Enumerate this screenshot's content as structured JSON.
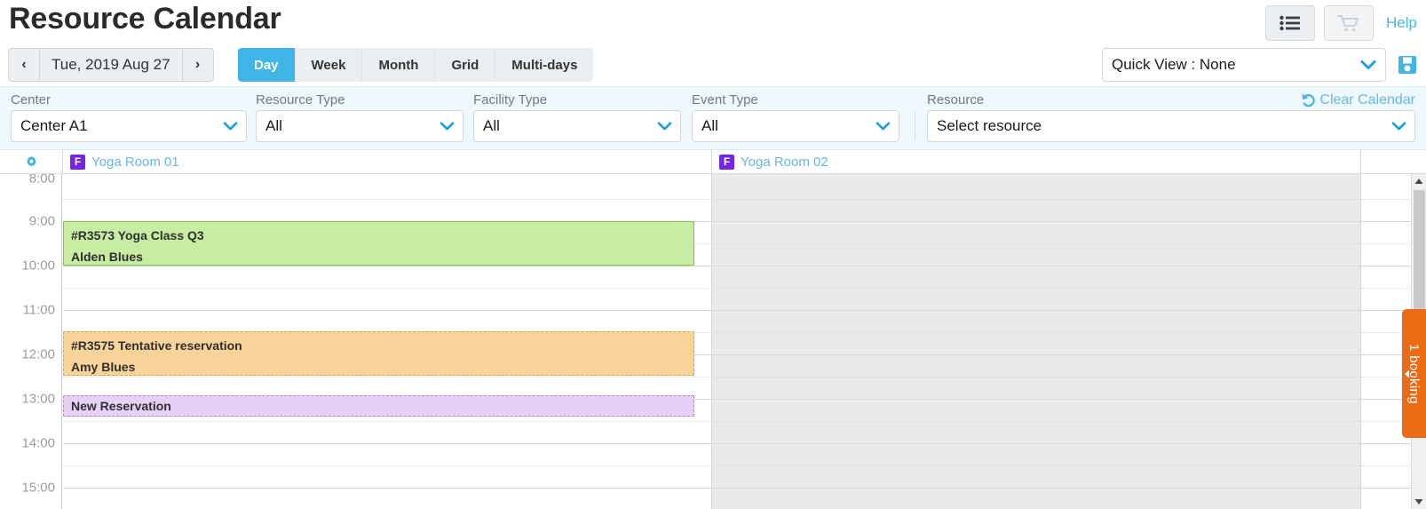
{
  "header": {
    "title": "Resource Calendar",
    "list_icon": "list-icon",
    "cart_icon": "cart-icon",
    "help_label": "Help"
  },
  "navbar": {
    "prev_label": "‹",
    "next_label": "›",
    "date_label": "Tue, 2019 Aug 27",
    "tabs": [
      {
        "label": "Day",
        "active": true
      },
      {
        "label": "Week",
        "active": false
      },
      {
        "label": "Month",
        "active": false
      },
      {
        "label": "Grid",
        "active": false
      },
      {
        "label": "Multi-days",
        "active": false
      }
    ],
    "quick_view_value": "Quick View : None",
    "save_icon": "save-icon"
  },
  "filters": [
    {
      "label": "Center",
      "value": "Center A1"
    },
    {
      "label": "Resource Type",
      "value": "All"
    },
    {
      "label": "Facility Type",
      "value": "All"
    },
    {
      "label": "Event Type",
      "value": "All"
    },
    {
      "label": "Resource",
      "value": "Select resource"
    }
  ],
  "clear_calendar": {
    "label": "Clear Calendar",
    "icon": "undo-icon"
  },
  "resources": [
    {
      "badge": "F",
      "name": "Yoga Room 01"
    },
    {
      "badge": "F",
      "name": "Yoga Room 02"
    }
  ],
  "gear_icon": "gear-icon",
  "calendar": {
    "time_labels": [
      "8:00",
      "9:00",
      "10:00",
      "11:00",
      "12:00",
      "13:00",
      "14:00",
      "15:00"
    ],
    "events": [
      {
        "title": "#R3573 Yoga Class Q3",
        "subtitle": "Alden Blues",
        "color": "green",
        "accent": "#7ac943",
        "fill": "#c7eda2"
      },
      {
        "title": "#R3575 Tentative reservation",
        "subtitle": "Amy Blues",
        "color": "orange",
        "accent": "#e0a03a",
        "fill": "#f9d49a"
      },
      {
        "title": "New Reservation",
        "subtitle": "",
        "color": "purple",
        "accent": "#b87fd6",
        "fill": "#e6d0f5"
      }
    ]
  },
  "booking_tab": {
    "label": "1 booking",
    "color": "#ee6b16"
  },
  "colors": {
    "accent_blue": "#41b6e6",
    "link_blue": "#67b8e3",
    "filter_bar_bg": "#eff8fd",
    "badge_purple": "#7526e3"
  }
}
